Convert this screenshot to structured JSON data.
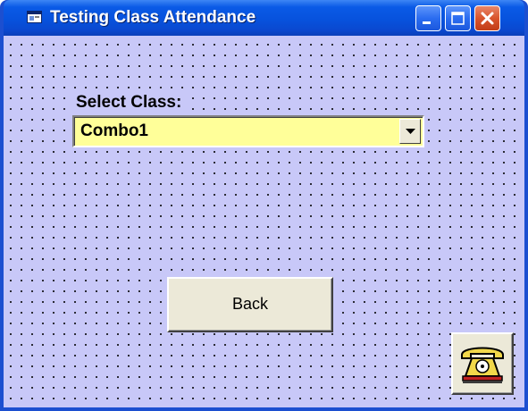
{
  "window": {
    "title": "Testing Class Attendance",
    "controls": [
      "minimize-icon",
      "maximize-icon",
      "close-icon"
    ]
  },
  "form": {
    "class_label": "Select Class:",
    "class_combo": {
      "value": "Combo1",
      "icon": "chevron-down-icon"
    },
    "back_button_label": "Back",
    "phone_button_icon": "telephone-icon"
  },
  "colors": {
    "titlebar": "#0752dd",
    "form_background": "#c8c8f8",
    "combo_background": "#ffff99",
    "button_face": "#ece9d8",
    "close_button": "#d9542c"
  }
}
